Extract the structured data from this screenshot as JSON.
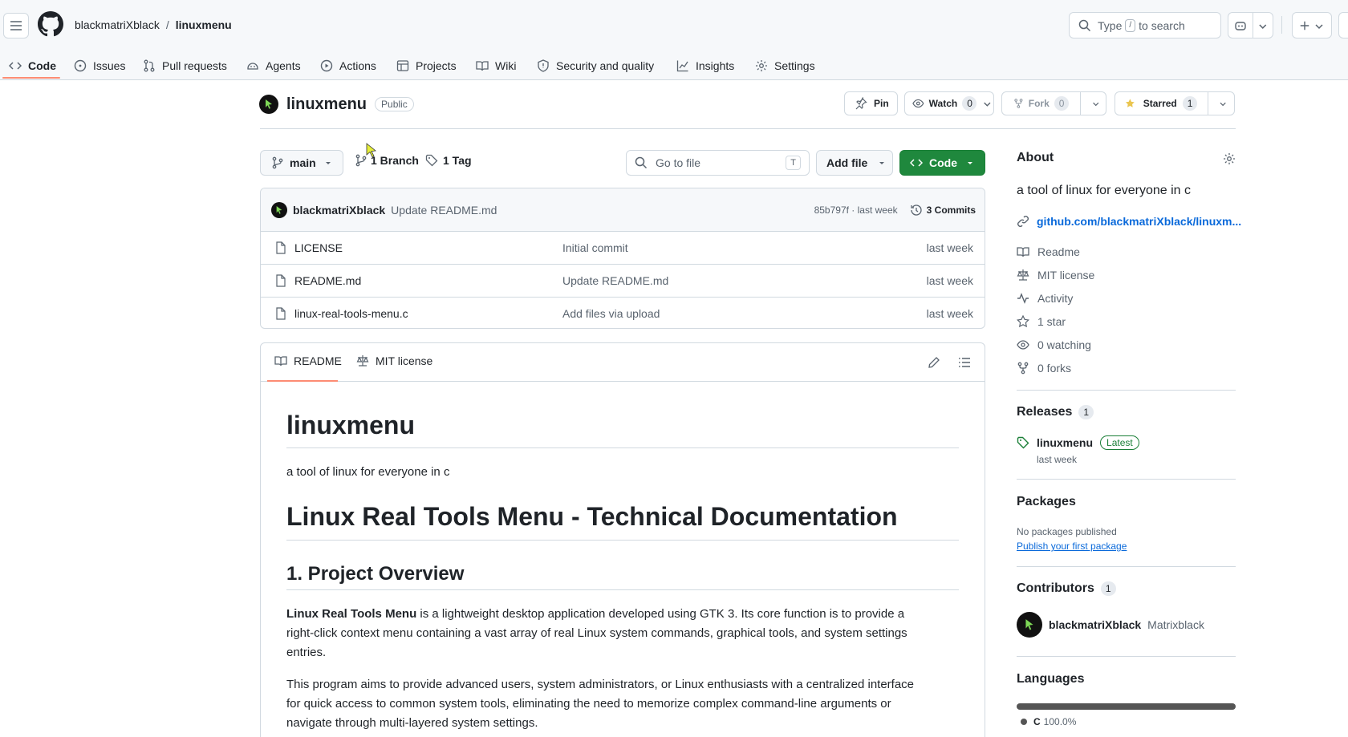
{
  "header": {
    "owner": "blackmatriXblack",
    "slash": "/",
    "repo": "linuxmenu",
    "search_prefix": "Type",
    "search_key": "/",
    "search_suffix": "to search"
  },
  "tabs": [
    {
      "label": "Code",
      "icon": "code-icon",
      "active": true
    },
    {
      "label": "Issues",
      "icon": "issue-icon"
    },
    {
      "label": "Pull requests",
      "icon": "pull-request-icon"
    },
    {
      "label": "Agents",
      "icon": "agent-icon"
    },
    {
      "label": "Actions",
      "icon": "play-icon"
    },
    {
      "label": "Projects",
      "icon": "table-icon"
    },
    {
      "label": "Wiki",
      "icon": "book-icon"
    },
    {
      "label": "Security and quality",
      "icon": "shield-icon"
    },
    {
      "label": "Insights",
      "icon": "graph-icon"
    },
    {
      "label": "Settings",
      "icon": "gear-icon"
    }
  ],
  "repo": {
    "name": "linuxmenu",
    "visibility": "Public",
    "pin_label": "Pin",
    "watch_label": "Watch",
    "watch_count": "0",
    "fork_label": "Fork",
    "fork_count": "0",
    "starred_label": "Starred",
    "star_count": "1"
  },
  "toolbar": {
    "branch": "main",
    "branches": "1 Branch",
    "tags": "1 Tag",
    "goto_placeholder": "Go to file",
    "goto_key": "T",
    "add_file": "Add file",
    "code": "Code"
  },
  "commit": {
    "author": "blackmatriXblack",
    "message": "Update README.md",
    "hash_time": "85b797f · last week",
    "commits": "3 Commits"
  },
  "files": [
    {
      "name": "LICENSE",
      "message": "Initial commit",
      "time": "last week"
    },
    {
      "name": "README.md",
      "message": "Update README.md",
      "time": "last week"
    },
    {
      "name": "linux-real-tools-menu.c",
      "message": "Add files via upload",
      "time": "last week"
    }
  ],
  "readme": {
    "tab_readme": "README",
    "tab_license": "MIT license",
    "h1": "linuxmenu",
    "intro": "a tool of linux for everyone in c",
    "h1b": "Linux Real Tools Menu - Technical Documentation",
    "h2": "1. Project Overview",
    "p1_bold": "Linux Real Tools Menu",
    "p1_l1": " is a lightweight desktop application developed using GTK 3. Its core function is to provide a",
    "p1_l2": "right-click context menu containing a vast array of real Linux system commands, graphical tools, and system settings",
    "p1_l3": "entries.",
    "p2_l1": "This program aims to provide advanced users, system administrators, or Linux enthusiasts with a centralized interface",
    "p2_l2": "for quick access to common system tools, eliminating the need to memorize complex command-line arguments or",
    "p2_l3": "navigate through multi-layered system settings."
  },
  "about": {
    "title": "About",
    "description": "a tool of linux for everyone in c",
    "link": "github.com/blackmatriXblack/linuxm...",
    "items": [
      {
        "label": "Readme",
        "icon": "book-icon"
      },
      {
        "label": "MIT license",
        "icon": "law-icon"
      },
      {
        "label": "Activity",
        "icon": "pulse-icon"
      },
      {
        "label": "1 star",
        "icon": "star-icon"
      },
      {
        "label": "0 watching",
        "icon": "eye-icon"
      },
      {
        "label": "0 forks",
        "icon": "fork-icon"
      }
    ]
  },
  "releases": {
    "title": "Releases",
    "count": "1",
    "name": "linuxmenu",
    "badge": "Latest",
    "time": "last week"
  },
  "packages": {
    "title": "Packages",
    "none": "No packages published",
    "link": "Publish your first package"
  },
  "contributors": {
    "title": "Contributors",
    "count": "1",
    "user": "blackmatriXblack",
    "display": "Matrixblack"
  },
  "languages": {
    "title": "Languages",
    "name": "C",
    "percent": "100.0%",
    "color": "#555555",
    "share": 100
  }
}
